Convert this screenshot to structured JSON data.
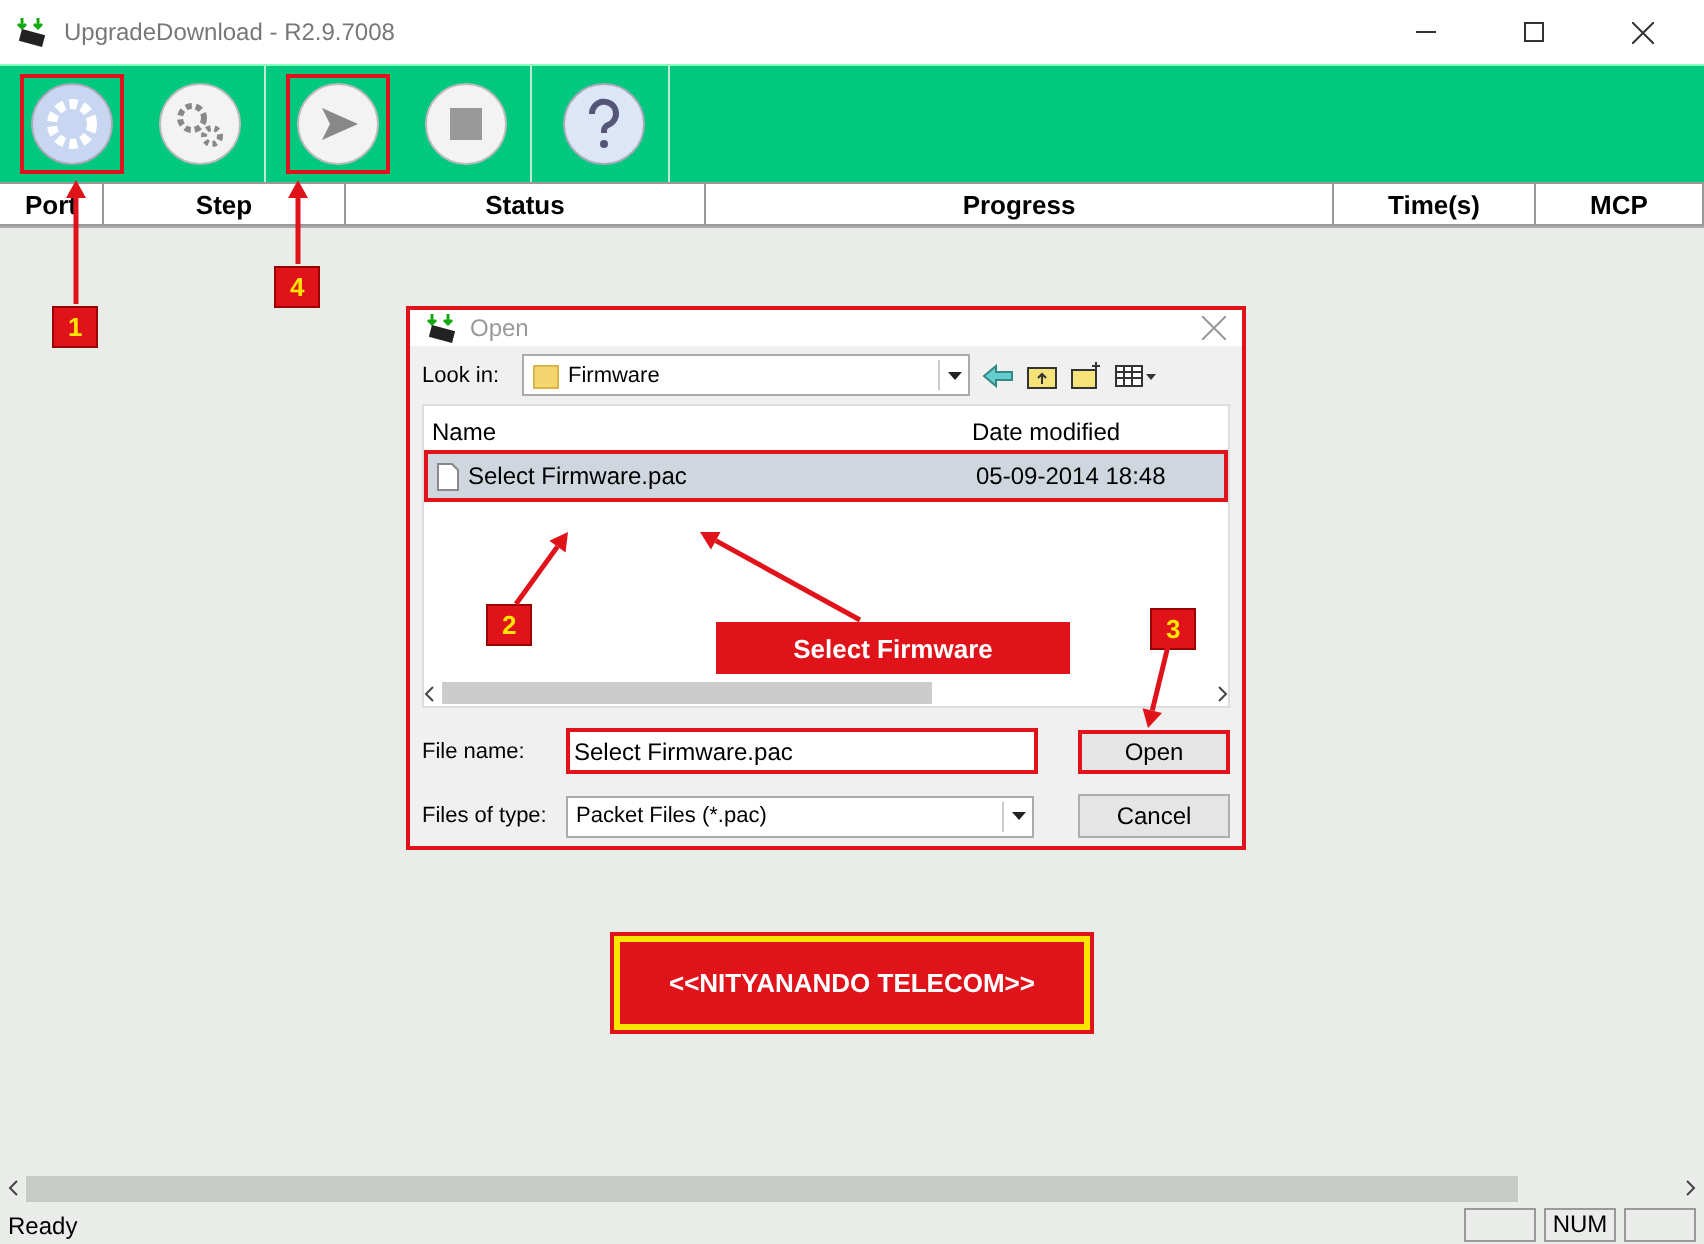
{
  "window": {
    "title": "UpgradeDownload - R2.9.7008"
  },
  "toolbar": {
    "buttons": [
      {
        "kind": "load",
        "highlighted": true,
        "badge": "1"
      },
      {
        "kind": "settings",
        "highlighted": false
      },
      {
        "kind": "start",
        "highlighted": true,
        "badge": "4"
      },
      {
        "kind": "stop",
        "highlighted": false
      },
      {
        "kind": "help",
        "highlighted": false
      }
    ]
  },
  "table": {
    "columns": [
      "Port",
      "Step",
      "Status",
      "Progress",
      "Time(s)",
      "MCP"
    ]
  },
  "dialog": {
    "title": "Open",
    "look_in_label": "Look in:",
    "look_in_value": "Firmware",
    "columns": [
      "Name",
      "Date modified"
    ],
    "files": [
      {
        "name": "Select Firmware.pac",
        "date": "05-09-2014 18:48",
        "selected": true
      }
    ],
    "file_name_label": "File name:",
    "file_name_value": "Select Firmware.pac",
    "file_type_label": "Files of type:",
    "file_type_value": "Packet Files (*.pac)",
    "open_button": "Open",
    "cancel_button": "Cancel"
  },
  "annotations": {
    "file_badge": "2",
    "open_badge": "3",
    "callout": "Select Firmware"
  },
  "banner": "<<NITYANANDO TELECOM>>",
  "status_bar": {
    "text": "Ready",
    "indicators": [
      "NUM"
    ]
  }
}
